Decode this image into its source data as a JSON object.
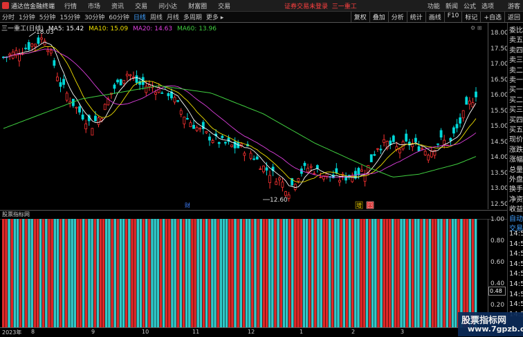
{
  "titlebar": {
    "app_name": "通达信金融终端",
    "menus": [
      "行情",
      "市场",
      "资讯",
      "交易",
      "问小达",
      "财富圈",
      "交易"
    ],
    "warning": "证券交易未登录",
    "stock_name": "三一重工",
    "right_items": [
      "功能",
      "新闻",
      "公式",
      "选项",
      "游客"
    ]
  },
  "periods": [
    "分时",
    "1分钟",
    "5分钟",
    "15分钟",
    "30分钟",
    "60分钟",
    "日线",
    "周线",
    "月线",
    "多周期",
    "更多 ▸"
  ],
  "active_period": "日线",
  "tools": [
    "复权",
    "叠加",
    "分析",
    "统计",
    "画线",
    "F10",
    "标记",
    "+自选",
    "返回"
  ],
  "ma_line": {
    "title": "三一重工(日线)",
    "ma5": "MA5: 15.42",
    "ma10": "MA10: 15.09",
    "ma20": "MA20: 14.63",
    "ma60": "MA60: 13.96"
  },
  "colors": {
    "up": "#ff3232",
    "down": "#00d8d8",
    "ma5": "#ffffff",
    "ma10": "#f0e000",
    "ma20": "#e040e0",
    "ma60": "#40d040",
    "bar_red": "#e02828",
    "bar_cyan": "#30c8c8"
  },
  "price_axis": [
    "18.00",
    "17.50",
    "17.00",
    "16.50",
    "16.00",
    "15.50",
    "15.00",
    "14.50",
    "14.00",
    "13.50",
    "13.00",
    "12.50"
  ],
  "annotations": {
    "high": "18.03",
    "low": "12.60",
    "marker_cai": "财",
    "marker_zeng": "增",
    "marker_hui": "回"
  },
  "right_labels": [
    "委比",
    "卖五",
    "卖四",
    "卖三",
    "卖二",
    "卖一",
    "买一",
    "买二",
    "买三",
    "买四",
    "买五",
    "现价",
    "涨跌",
    "涨幅",
    "总量",
    "外盘",
    "换手",
    "净资",
    "收益",
    "自动",
    "交易",
    "14:56",
    "14:56",
    "14:56",
    "14:56",
    "14:56",
    "14:56",
    "14:56",
    "14:56",
    "14:56"
  ],
  "indicator": {
    "title": "股票指标网",
    "axis": [
      "1.00",
      "0.80",
      "0.60",
      "0.40",
      "0.20"
    ],
    "current": "0.48",
    "bars": [
      1,
      1,
      0,
      1,
      0,
      0,
      1,
      0,
      1,
      0,
      0,
      1,
      1,
      0,
      1,
      0,
      1,
      1,
      0,
      0,
      1,
      0,
      1,
      0,
      0,
      0,
      1,
      1,
      0,
      1,
      0,
      0,
      1,
      0,
      1,
      1,
      0,
      0,
      1,
      0,
      1,
      0,
      0,
      1,
      0,
      1,
      1,
      0,
      0,
      1,
      0,
      1,
      0,
      0,
      0,
      1,
      0,
      1,
      1,
      0,
      0,
      1,
      0,
      1,
      0,
      0,
      1,
      1,
      0,
      0,
      1,
      0,
      1,
      0,
      0,
      1,
      0,
      0,
      0,
      1,
      1,
      0,
      1,
      0,
      1,
      0,
      0,
      1,
      0,
      1,
      0,
      1,
      1,
      0,
      0,
      1,
      0,
      1,
      0,
      0,
      1,
      0,
      1,
      1,
      1,
      0,
      0,
      1,
      0,
      1,
      0,
      0,
      1,
      1,
      0,
      1,
      0,
      0,
      1,
      0,
      1,
      0,
      1,
      0,
      0,
      1,
      1,
      0,
      1,
      0,
      0,
      1,
      0,
      1,
      1,
      1,
      0,
      1,
      1,
      0,
      0,
      1,
      0,
      1,
      0,
      0,
      1,
      0,
      1,
      0,
      1,
      1,
      0,
      0,
      1,
      0,
      1,
      0,
      0,
      1,
      0,
      1,
      1,
      0,
      1,
      0
    ]
  },
  "x_axis": [
    {
      "label": "2023年",
      "pos": 0
    },
    {
      "label": "8",
      "pos": 0
    },
    {
      "label": "9",
      "pos": 0
    },
    {
      "label": "10",
      "pos": 0
    },
    {
      "label": "11",
      "pos": 0
    },
    {
      "label": "12",
      "pos": 0
    },
    {
      "label": "1",
      "pos": 0
    },
    {
      "label": "2",
      "pos": 0
    },
    {
      "label": "3",
      "pos": 0
    }
  ],
  "watermark": {
    "line1": "股票指标网",
    "line2": "www.7gpzb.com"
  }
}
